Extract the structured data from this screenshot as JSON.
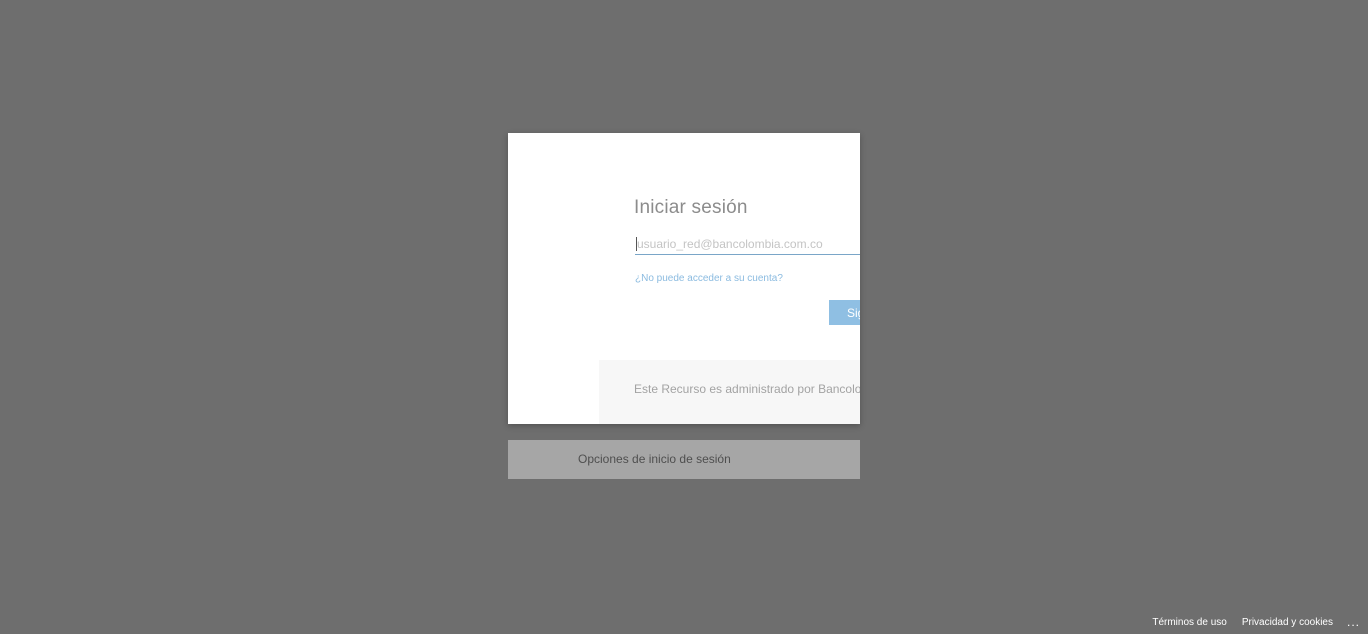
{
  "login": {
    "title": "Iniciar sesión",
    "email_placeholder": "usuario_red@bancolombia.com.co",
    "email_value": "",
    "help_link": "¿No puede acceder a su cuenta?",
    "next_button": "Siguiente",
    "footer_text": "Este Recurso es administrado por Bancolombia"
  },
  "signin_options": {
    "label": "Opciones de inicio de sesión"
  },
  "footer": {
    "terms": "Términos de uso",
    "privacy": "Privacidad y cookies",
    "more": "..."
  },
  "colors": {
    "backdrop": "#6e6e6e",
    "accent": "#8fbfe3",
    "link": "#8bbbe0"
  }
}
